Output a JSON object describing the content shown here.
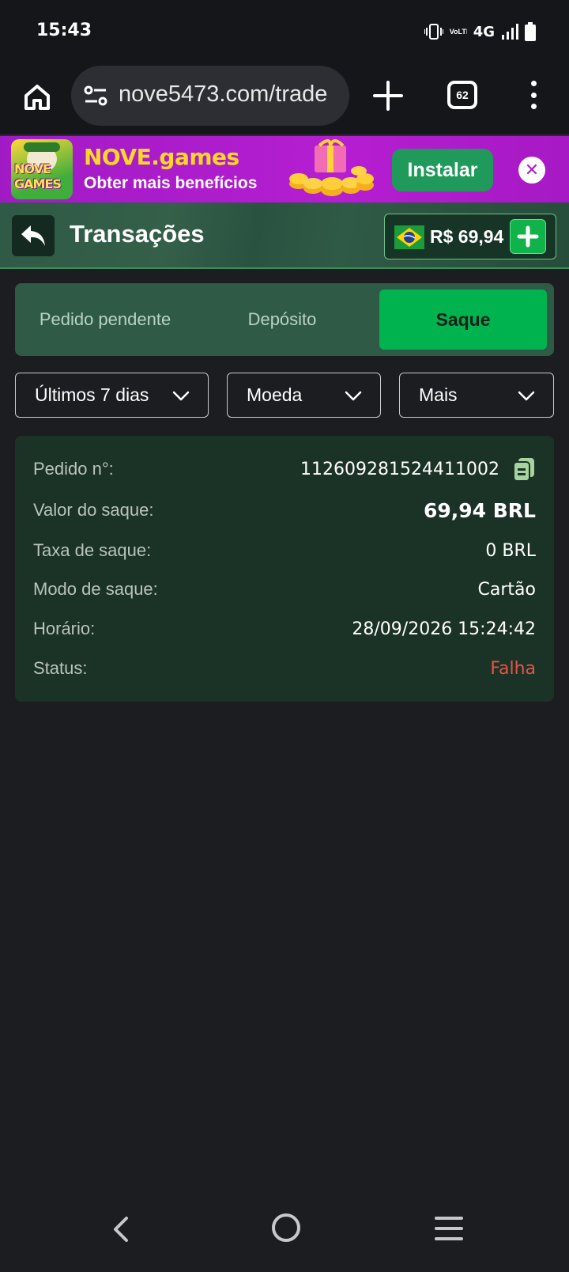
{
  "status_bar": {
    "time": "15:43",
    "network": "4G",
    "volte": "VoLTE",
    "icons": [
      "vibrate-icon",
      "volte-icon",
      "signal-icon",
      "battery-icon"
    ]
  },
  "browser": {
    "url": "nove5473.com/trade",
    "tab_count": "62",
    "icons": [
      "home-icon",
      "site-settings-icon",
      "plus-icon",
      "tabs-icon",
      "more-vert-icon"
    ]
  },
  "promo": {
    "title": "NOVE.games",
    "subtitle": "Obter mais benefícios",
    "install_label": "Instalar",
    "close_symbol": "✕",
    "logo_text": "NOVE GAMES"
  },
  "header": {
    "title": "Transações",
    "balance": "R$ 69,94",
    "flag": "brazil-flag-icon"
  },
  "tabs": [
    {
      "label": "Pedido pendente",
      "active": false
    },
    {
      "label": "Depósito",
      "active": false
    },
    {
      "label": "Saque",
      "active": true
    }
  ],
  "filters": {
    "period": "Últimos 7 dias",
    "currency": "Moeda",
    "more": "Mais"
  },
  "transaction": {
    "order_label": "Pedido n°:",
    "order_value": "112609281524411002",
    "amount_label": "Valor do saque:",
    "amount_value": "69,94 BRL",
    "fee_label": "Taxa de saque:",
    "fee_value": "0 BRL",
    "mode_label": "Modo de saque:",
    "mode_value": "Cartão",
    "time_label": "Horário:",
    "time_value": "28/09/2026 15:24:42",
    "status_label": "Status:",
    "status_value": "Falha"
  },
  "colors": {
    "accent_green": "#00b34f",
    "header_green": "#2f5a45",
    "card_bg": "#1b3226",
    "promo_purple": "#b51ed1",
    "status_fail": "#e45548"
  }
}
